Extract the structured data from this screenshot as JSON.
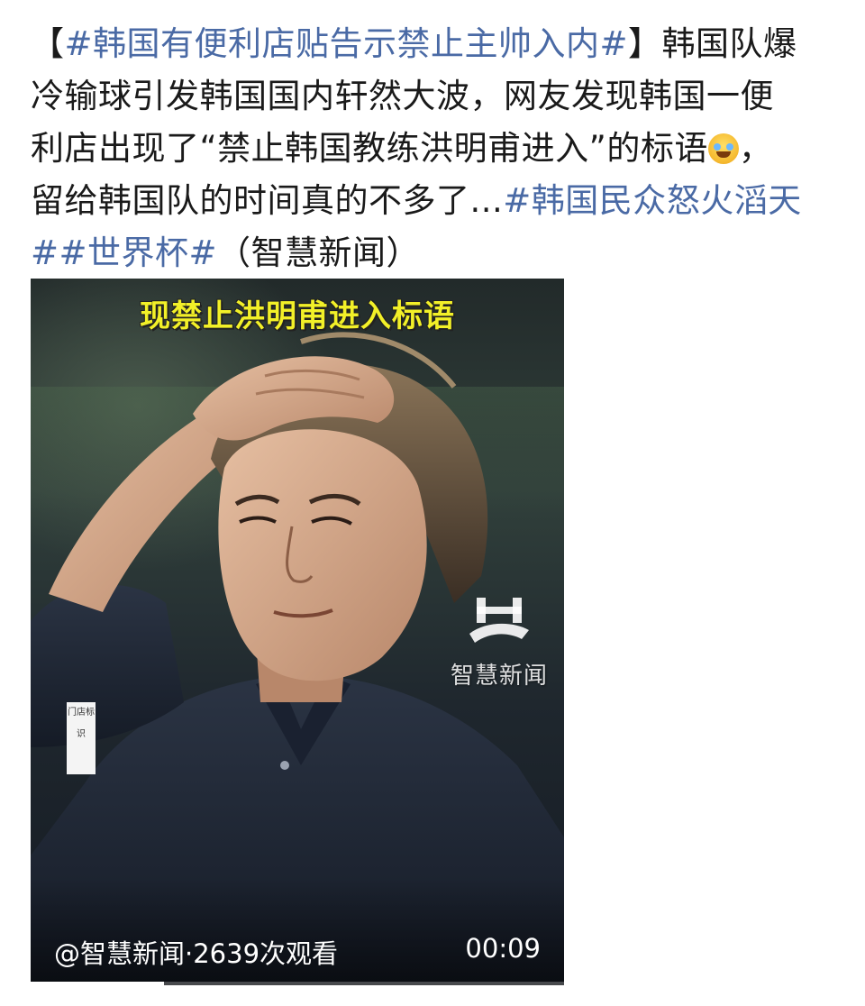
{
  "post": {
    "topic_tag": "#韩国有便利店贴告示禁止主帅入内#",
    "bracket_open": "【",
    "bracket_close": "】",
    "line1_rest": "韩国队爆",
    "line2": "冷输球引发韩国国内轩然大波，网友发现韩国一便",
    "line3_before_emoji": "利店出现了“禁止韩国教练洪明甫进入”的标语",
    "line3_after_emoji": "，",
    "line4_text": "留给韩国队的时间真的不多了...",
    "tag_korea_anger": "#韩国民众怒火滔天",
    "tag_korea_anger_end": "#",
    "tag_world_cup": "#世界杯#",
    "source": "（智慧新闻）",
    "emoji_icon": "laughing-crying-emoji"
  },
  "video": {
    "banner_text": "现禁止洪明甫进入标语",
    "watermark_text": "智慧新闻",
    "watermark_logo": "zhihui-news-logo",
    "side_label": "门店标识",
    "author_line": "@智慧新闻·2639次观看",
    "duration": "00:09",
    "progress": 0.25
  },
  "colors": {
    "link": "#4a6aa5",
    "text": "#1a1a1a",
    "banner": "#f2f028"
  }
}
